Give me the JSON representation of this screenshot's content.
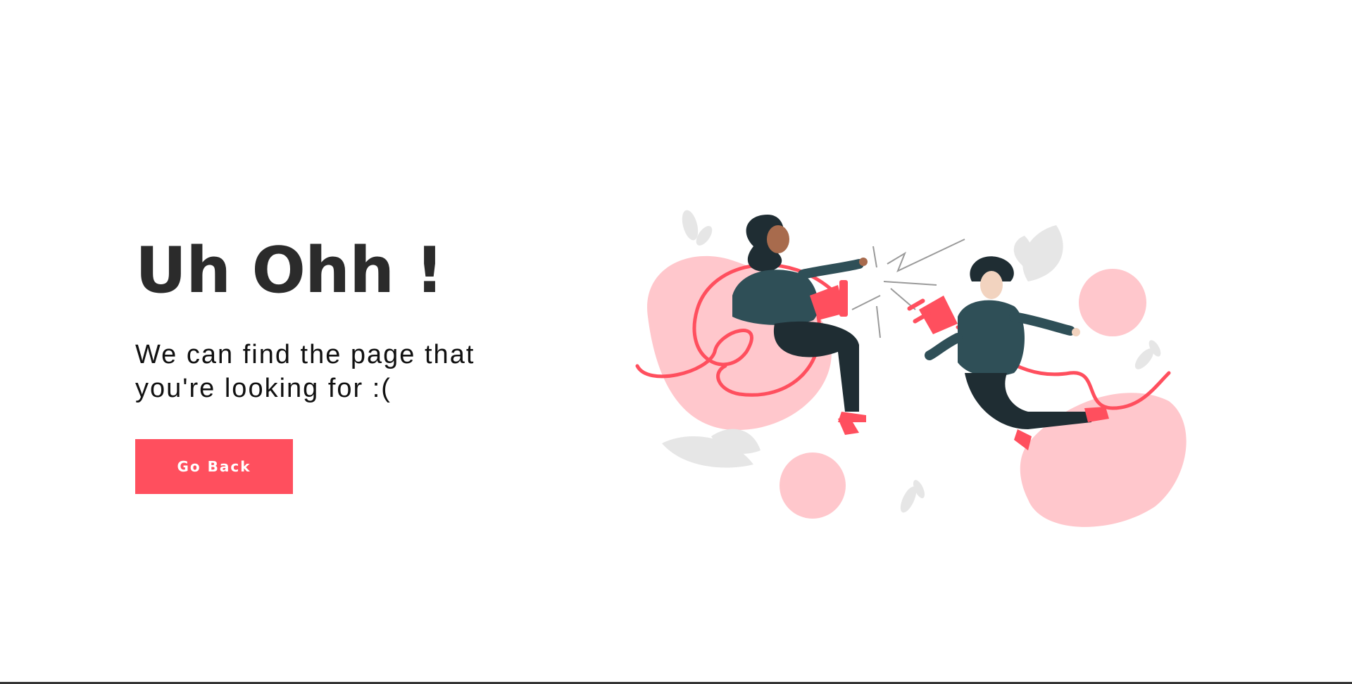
{
  "error_page": {
    "title": "Uh Ohh !",
    "message": "We can find the page that you're looking for :(",
    "button_label": "Go Back",
    "illustration": "unplugged-cable-illustration"
  },
  "colors": {
    "accent": "#ff4f5e",
    "blob": "#ffc7cc",
    "leaf": "#e8e8e8",
    "clothing": "#2f4f57",
    "pants": "#1f2d33",
    "title": "#2b2b2b"
  }
}
